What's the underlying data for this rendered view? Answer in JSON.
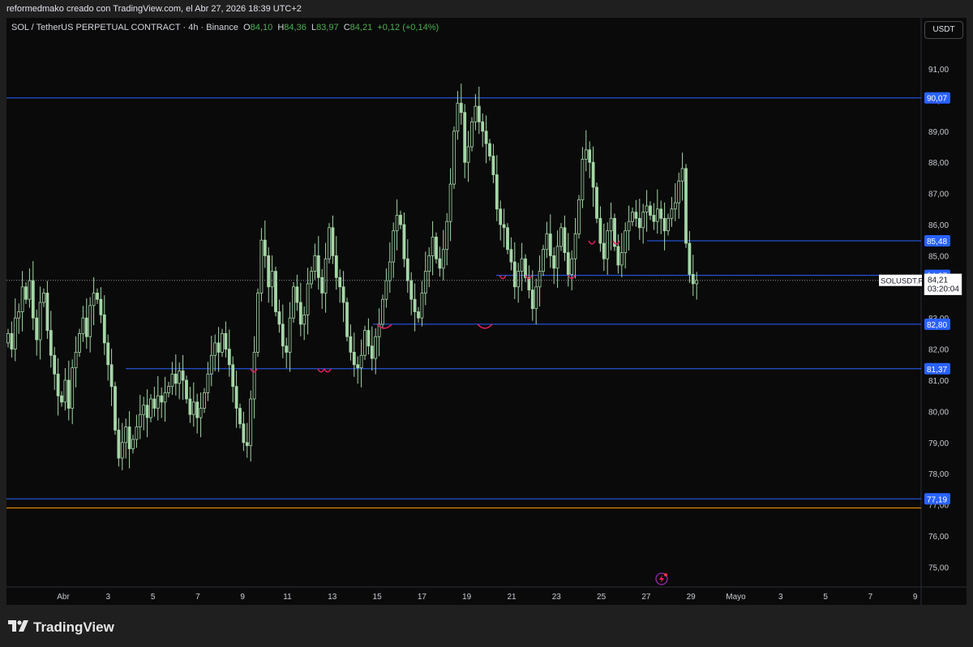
{
  "header": {
    "attribution": "reformedmako creado con TradingView.com, el Abr 27, 2026 18:39 UTC+2"
  },
  "legend": {
    "symbol": "SOL / TetherUS PERPETUAL CONTRACT · 4h · Binance",
    "o_label": "O",
    "o_value": "84,10",
    "h_label": "H",
    "h_value": "84,36",
    "l_label": "L",
    "l_value": "83,97",
    "c_label": "C",
    "c_value": "84,21",
    "change": "+0,12 (+0,14%)"
  },
  "currency_button": "USDT",
  "brand": {
    "name": "TradingView"
  },
  "colors": {
    "background": "#0a0a0a",
    "candle": "#a5d6a7",
    "level_line": "#2962ff",
    "support_line": "#ff9800",
    "marker": "#e91e63",
    "tag_bg": "#2962ff"
  },
  "icons": {
    "alert": "lightning-alert-icon",
    "logo": "tradingview-logo-icon"
  },
  "chart_data": {
    "type": "candlestick",
    "symbol": "SOLUSDT.P",
    "timeframe": "4h",
    "current_price": 84.21,
    "current_price_label": "84,21",
    "countdown": "03:20:04",
    "symbol_tag": "SOLUSDT.P",
    "price_axis": {
      "min": 74.5,
      "max": 91.4,
      "ticks": [
        "91,00",
        "90,00",
        "89,00",
        "88,00",
        "87,00",
        "86,00",
        "85,00",
        "84,00",
        "83,00",
        "82,00",
        "81,00",
        "80,00",
        "79,00",
        "78,00",
        "77,00",
        "76,00",
        "75,00"
      ]
    },
    "time_axis": {
      "labels": [
        "Abr",
        "3",
        "5",
        "7",
        "9",
        "11",
        "13",
        "15",
        "17",
        "19",
        "21",
        "23",
        "25",
        "27",
        "29",
        "Mayo",
        "3",
        "5",
        "7",
        "9"
      ]
    },
    "levels": [
      {
        "value": 90.07,
        "label": "90,07",
        "color": "#2962ff"
      },
      {
        "value": 85.48,
        "label": "85,48",
        "color": "#2962ff"
      },
      {
        "value": 84.37,
        "label": "84,37",
        "color": "#2962ff"
      },
      {
        "value": 82.8,
        "label": "82,80",
        "color": "#2962ff"
      },
      {
        "value": 81.37,
        "label": "81,37",
        "color": "#2962ff"
      },
      {
        "value": 77.19,
        "label": "77,19",
        "color": "#2962ff"
      },
      {
        "value": 76.9,
        "label": "",
        "color": "#ff9800"
      }
    ],
    "closes": [
      82.5,
      82.0,
      83.0,
      83.2,
      84.0,
      83.6,
      84.2,
      83.0,
      82.3,
      83.5,
      83.8,
      82.6,
      81.8,
      81.2,
      80.5,
      80.3,
      81.0,
      80.1,
      81.4,
      81.9,
      82.5,
      83.0,
      82.4,
      83.4,
      83.8,
      83.6,
      83.1,
      82.2,
      81.5,
      80.8,
      79.4,
      78.5,
      79.0,
      79.5,
      78.8,
      79.1,
      79.5,
      79.9,
      80.2,
      79.8,
      80.4,
      80.1,
      80.5,
      80.3,
      80.6,
      80.8,
      81.2,
      80.9,
      81.3,
      81.0,
      80.4,
      79.9,
      80.3,
      79.8,
      80.1,
      80.6,
      81.2,
      81.8,
      82.2,
      81.9,
      82.5,
      82.0,
      81.5,
      80.8,
      80.1,
      79.6,
      79.0,
      78.9,
      80.4,
      81.9,
      83.8,
      85.5,
      85.0,
      84.0,
      84.5,
      83.2,
      82.8,
      82.1,
      81.9,
      83.0,
      84.0,
      83.5,
      82.8,
      83.1,
      84.1,
      84.5,
      85.0,
      84.3,
      83.8,
      84.9,
      85.9,
      85.0,
      84.3,
      84.0,
      83.5,
      82.4,
      81.9,
      81.5,
      81.4,
      81.8,
      82.6,
      82.1,
      81.7,
      82.4,
      82.8,
      83.6,
      84.2,
      84.8,
      85.8,
      86.3,
      86.0,
      84.9,
      84.2,
      83.6,
      83.2,
      83.0,
      83.8,
      84.5,
      85.0,
      85.6,
      84.9,
      84.6,
      85.2,
      86.1,
      87.3,
      89.0,
      89.9,
      89.6,
      88.0,
      88.5,
      89.3,
      89.8,
      89.3,
      89.0,
      88.6,
      88.2,
      87.6,
      86.5,
      86.0,
      85.9,
      85.2,
      84.8,
      84.0,
      84.5,
      84.9,
      84.3,
      83.9,
      83.3,
      84.0,
      84.5,
      85.2,
      85.7,
      85.0,
      84.6,
      85.3,
      85.9,
      85.1,
      84.4,
      84.9,
      85.7,
      86.8,
      88.1,
      88.4,
      88.0,
      87.2,
      86.2,
      85.4,
      84.9,
      85.8,
      86.2,
      85.3,
      84.7,
      85.1,
      85.8,
      86.1,
      86.4,
      86.2,
      85.9,
      86.4,
      86.6,
      86.3,
      86.1,
      86.5,
      86.2,
      85.8,
      86.2,
      86.5,
      86.7,
      87.4,
      87.8,
      85.4,
      84.4,
      84.1,
      84.21
    ],
    "markers": [
      {
        "price": 82.8,
        "label": ""
      },
      {
        "price": 81.37,
        "label": ""
      },
      {
        "price": 84.37,
        "label": ""
      },
      {
        "price": 85.48,
        "label": ""
      }
    ]
  }
}
